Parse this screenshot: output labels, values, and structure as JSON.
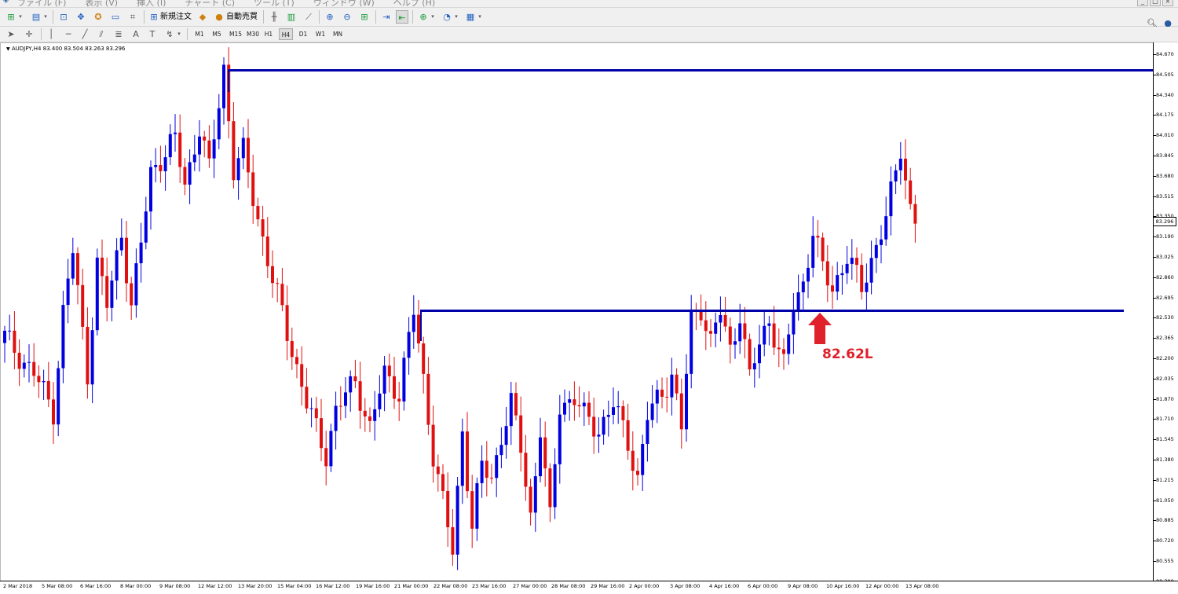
{
  "menu": {
    "items": [
      "ファイル (F)",
      "表示 (V)",
      "挿入 (I)",
      "チャート (C)",
      "ツール (T)",
      "ウィンドウ (W)",
      "ヘルプ (H)"
    ]
  },
  "toolbar": {
    "new_order_label": "新規注文",
    "auto_trade_label": "自動売買",
    "timeframes": [
      "M1",
      "M5",
      "M15",
      "M30",
      "H1",
      "H4",
      "D1",
      "W1",
      "MN"
    ],
    "active_timeframe": "H4"
  },
  "chart": {
    "header": "AUDJPY,H4  83.400 83.504 83.263 83.296",
    "current_price": "83.296",
    "annotation": "82.62L",
    "colors": {
      "bull": "#0000e0",
      "bear": "#e01010",
      "level_line": "#0000a8",
      "arrow": "#e0202a"
    },
    "price_axis": [
      "84.670",
      "84.505",
      "84.340",
      "84.175",
      "84.010",
      "83.845",
      "83.680",
      "83.515",
      "83.350",
      "83.190",
      "83.025",
      "82.860",
      "82.695",
      "82.530",
      "82.365",
      "82.200",
      "82.035",
      "81.870",
      "81.710",
      "81.545",
      "81.380",
      "81.215",
      "81.050",
      "80.885",
      "80.720",
      "80.555",
      "80.390"
    ],
    "time_axis": [
      "2 Mar 2018",
      "5 Mar 08:00",
      "6 Mar 16:00",
      "8 Mar 00:00",
      "9 Mar 08:00",
      "12 Mar 12:00",
      "13 Mar 20:00",
      "15 Mar 04:00",
      "16 Mar 12:00",
      "19 Mar 16:00",
      "21 Mar 00:00",
      "22 Mar 08:00",
      "23 Mar 16:00",
      "27 Mar 00:00",
      "28 Mar 08:00",
      "29 Mar 16:00",
      "2 Apr 00:00",
      "3 Apr 08:00",
      "4 Apr 16:00",
      "6 Apr 00:00",
      "9 Apr 08:00",
      "10 Apr 16:00",
      "12 Apr 00:00",
      "13 Apr 08:00"
    ],
    "resistance_level": 84.51,
    "support_level": 82.56
  }
}
